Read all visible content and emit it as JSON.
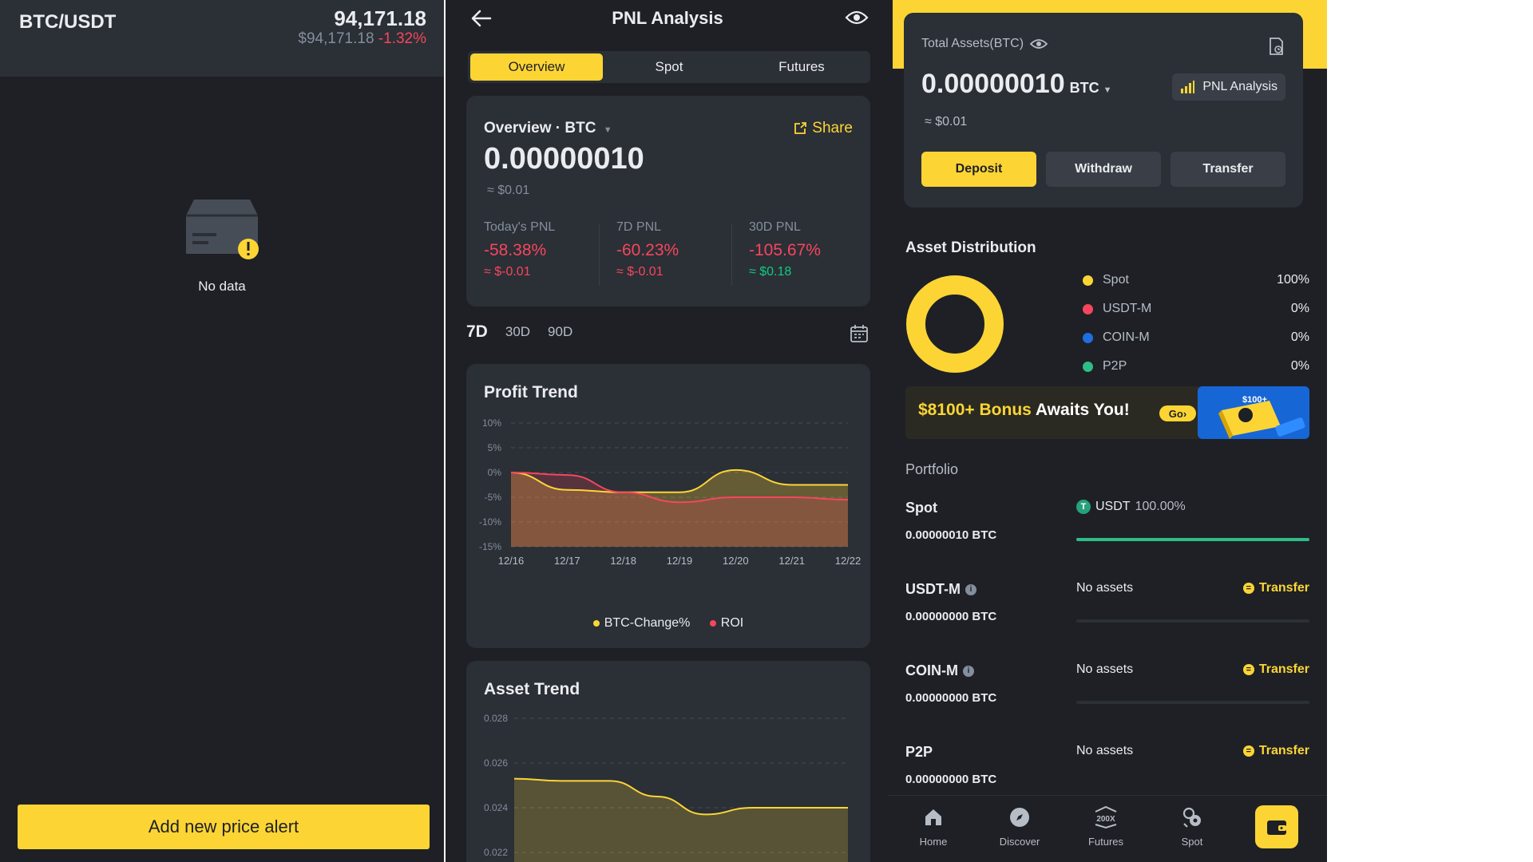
{
  "alerts_panel": {
    "pair": "BTC/USDT",
    "price": "94,171.18",
    "price_usd": "$94,171.18",
    "change": "-1.32%",
    "empty_text": "No data",
    "add_button": "Add new price alert"
  },
  "pnl_panel": {
    "title": "PNL Analysis",
    "tabs": [
      "Overview",
      "Spot",
      "Futures"
    ],
    "overview_label": "Overview",
    "currency": "BTC",
    "share": "Share",
    "amount": "0.00000010",
    "approx": "≈ $0.01",
    "pnl": [
      {
        "label": "Today's PNL",
        "pct": "-58.38%",
        "amt": "≈ $-0.01"
      },
      {
        "label": "7D PNL",
        "pct": "-60.23%",
        "amt": "≈ $-0.01"
      },
      {
        "label": "30D PNL",
        "pct": "-105.67%",
        "amt": "≈ $0.18"
      }
    ],
    "ranges": [
      "7D",
      "30D",
      "90D"
    ],
    "profit_trend_title": "Profit Trend",
    "asset_trend_title": "Asset Trend",
    "colors": {
      "btc": "#fcd535",
      "roi": "#f6465d",
      "accent": "#fcd535"
    }
  },
  "chart_data": [
    {
      "type": "line",
      "title": "Profit Trend",
      "x": [
        "12/16",
        "12/17",
        "12/18",
        "12/19",
        "12/20",
        "12/21",
        "12/22"
      ],
      "yticks": [
        "10%",
        "5%",
        "0%",
        "-5%",
        "-10%",
        "-15%"
      ],
      "ylim": [
        -15,
        10
      ],
      "series": [
        {
          "name": "BTC-Change%",
          "values": [
            0,
            -3.5,
            -4,
            -4,
            0.5,
            -2.5,
            -2.5
          ]
        },
        {
          "name": "ROI",
          "values": [
            0,
            -0.5,
            -4,
            -6,
            -5,
            -5,
            -5.5
          ]
        }
      ],
      "grid": true,
      "legend": "bottom"
    },
    {
      "type": "area",
      "title": "Asset Trend",
      "yticks": [
        "0.028",
        "0.026",
        "0.024",
        "0.022"
      ],
      "ylim": [
        0.021,
        0.028
      ],
      "series": [
        {
          "values": [
            0.0253,
            0.0252,
            0.0252,
            0.0245,
            0.0237,
            0.024,
            0.024,
            0.024
          ]
        }
      ],
      "grid": true
    }
  ],
  "wallet_panel": {
    "total_label": "Total Assets(BTC)",
    "amount": "0.00000010",
    "unit": "BTC",
    "approx": "≈ $0.01",
    "pnl_chip": "PNL Analysis",
    "buttons": [
      "Deposit",
      "Withdraw",
      "Transfer"
    ],
    "dist_title": "Asset Distribution",
    "distribution": [
      {
        "name": "Spot",
        "value": "100%",
        "color": "#fcd535"
      },
      {
        "name": "USDT-M",
        "value": "0%",
        "color": "#f6465d"
      },
      {
        "name": "COIN-M",
        "value": "0%",
        "color": "#1e6fe0"
      },
      {
        "name": "P2P",
        "value": "0%",
        "color": "#2ebd85"
      }
    ],
    "banner": {
      "amount": "$8100+ Bonus",
      "rest": " Awaits You!",
      "go": "Go",
      "badge": "$100+"
    },
    "portfolio_label": "Portfolio",
    "portfolio": [
      {
        "name": "Spot",
        "amount": "0.00000010 BTC",
        "asset": "USDT",
        "asset_pct": "100.00%",
        "fill": 1.0
      },
      {
        "name": "USDT-M",
        "amount": "0.00000000 BTC",
        "status": "No assets",
        "action": "Transfer"
      },
      {
        "name": "COIN-M",
        "amount": "0.00000000 BTC",
        "status": "No assets",
        "action": "Transfer"
      },
      {
        "name": "P2P",
        "amount": "0.00000000 BTC",
        "status": "No assets",
        "action": "Transfer"
      }
    ],
    "nav": [
      "Home",
      "Discover",
      "Futures",
      "Spot"
    ],
    "nav_futures_badge": "200X"
  }
}
